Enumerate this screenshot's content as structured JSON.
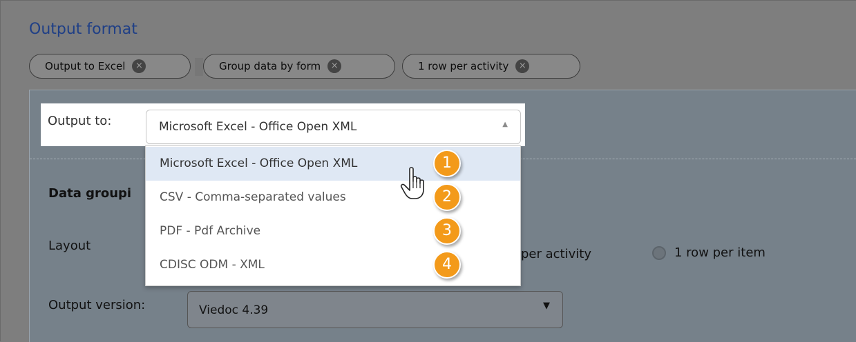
{
  "section": {
    "title": "Output format"
  },
  "chips": [
    {
      "label": "Output to Excel",
      "remove_glyph": "×"
    },
    {
      "label": "Group data by form",
      "remove_glyph": "×"
    },
    {
      "label": "1 row per activity",
      "remove_glyph": "×"
    }
  ],
  "output_to": {
    "label": "Output to:",
    "selected": "Microsoft Excel - Office Open XML",
    "arrow_glyph": "▲",
    "options": [
      "Microsoft Excel - Office Open XML",
      "CSV - Comma-separated values",
      "PDF - Pdf Archive",
      "CDISC ODM - XML"
    ],
    "highlighted_index": 0
  },
  "background_form": {
    "data_grouping_label": "Data groupi",
    "layout_label": "Layout",
    "per_activity_fragment": "per activity",
    "row_per_item_label": "1 row per item",
    "output_version_label": "Output version:",
    "output_version_value": "Viedoc 4.39",
    "output_version_arrow": "▼"
  },
  "badges": [
    "1",
    "2",
    "3",
    "4"
  ],
  "colors": {
    "overlay_gray": "#7e7e7e",
    "title_blue": "#1f3f86",
    "highlight": "#dfe8f4",
    "badge_orange": "#f39a1a"
  },
  "icons": {
    "chip_remove": "close-circle-icon",
    "select_arrow": "caret-up-icon",
    "version_arrow": "caret-down-icon",
    "cursor": "hand-pointer-icon"
  }
}
